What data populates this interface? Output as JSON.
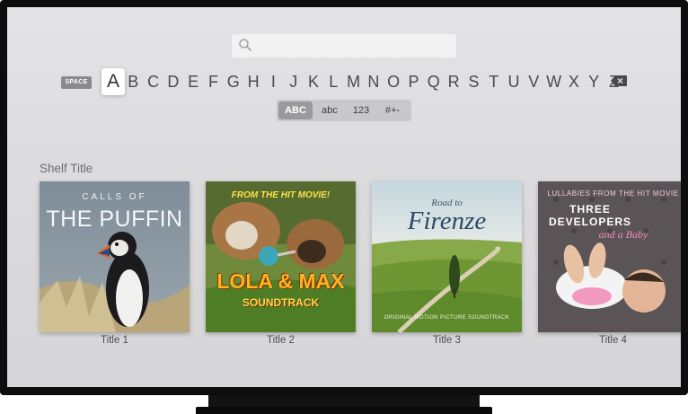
{
  "keyboard": {
    "space_label": "SPACE",
    "letters": [
      "A",
      "B",
      "C",
      "D",
      "E",
      "F",
      "G",
      "H",
      "I",
      "J",
      "K",
      "L",
      "M",
      "N",
      "O",
      "P",
      "Q",
      "R",
      "S",
      "T",
      "U",
      "V",
      "W",
      "X",
      "Y",
      "Z"
    ],
    "focused_letter": "A",
    "modes": [
      "ABC",
      "abc",
      "123",
      "#+-"
    ],
    "selected_mode": "ABC"
  },
  "shelf": {
    "title": "Shelf Title",
    "items": [
      {
        "title": "Title 1",
        "art_lines": [
          "CALLS OF",
          "THE PUFFIN"
        ]
      },
      {
        "title": "Title 2",
        "art_lines": [
          "FROM THE HIT MOVIE!",
          "LOLA & MAX",
          "SOUNDTRACK"
        ]
      },
      {
        "title": "Title 3",
        "art_lines": [
          "Road to",
          "Firenze",
          "ORIGINAL MOTION PICTURE SOUNDTRACK"
        ]
      },
      {
        "title": "Title 4",
        "art_lines": [
          "LULLABIES FROM THE HIT MOVIE",
          "THREE DEVELOPERS",
          "and a Baby"
        ]
      }
    ]
  },
  "colors": {
    "bezel": "#0d0d0d",
    "screen": "#dcdcde",
    "focus": "#ffffff"
  }
}
